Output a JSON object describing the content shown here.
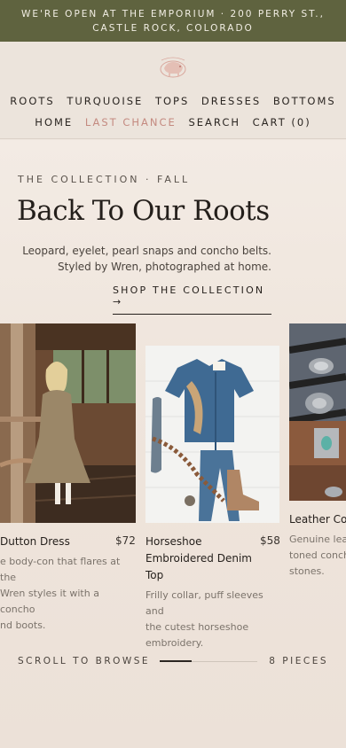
{
  "announcement": {
    "line1": "WE'RE OPEN AT THE EMPORIUM · 200 PERRY ST.,",
    "line2": "CASTLE ROCK, COLORADO"
  },
  "nav": {
    "row1": [
      "ROOTS",
      "TURQUOISE",
      "TOPS",
      "DRESSES",
      "BOTTOMS"
    ],
    "home": "HOME",
    "last_chance": "LAST CHANCE",
    "search": "SEARCH",
    "cart": "CART (0)"
  },
  "hero": {
    "eyebrow": "THE COLLECTION · FALL",
    "title": "Back To Our Roots",
    "desc_line1": "Leopard, eyelet, pearl snaps and concho belts.",
    "desc_line2": "Styled by Wren, photographed at home.",
    "cta": "SHOP THE COLLECTION →"
  },
  "products": [
    {
      "name": "Dutton Dress",
      "price": "$72",
      "blurb_lines": [
        "e body-con that flares at the",
        "Wren styles it with a concho",
        "nd boots."
      ]
    },
    {
      "name_lines": [
        "Horseshoe",
        "Embroidered Denim",
        "Top"
      ],
      "price": "$58",
      "blurb_lines": [
        "Frilly collar, puff sleeves and",
        "the cutest horseshoe",
        "embroidery."
      ]
    },
    {
      "name": "Leather Con",
      "blurb_lines": [
        "Genuine leat",
        "toned concho",
        "stones."
      ]
    }
  ],
  "scroll": {
    "label": "SCROLL TO BROWSE",
    "count": "8 PIECES",
    "progress": 0.33
  },
  "colors": {
    "announcement_bg": "#5f633f",
    "accent": "#c48a80",
    "page_bg": "#efe6de"
  }
}
